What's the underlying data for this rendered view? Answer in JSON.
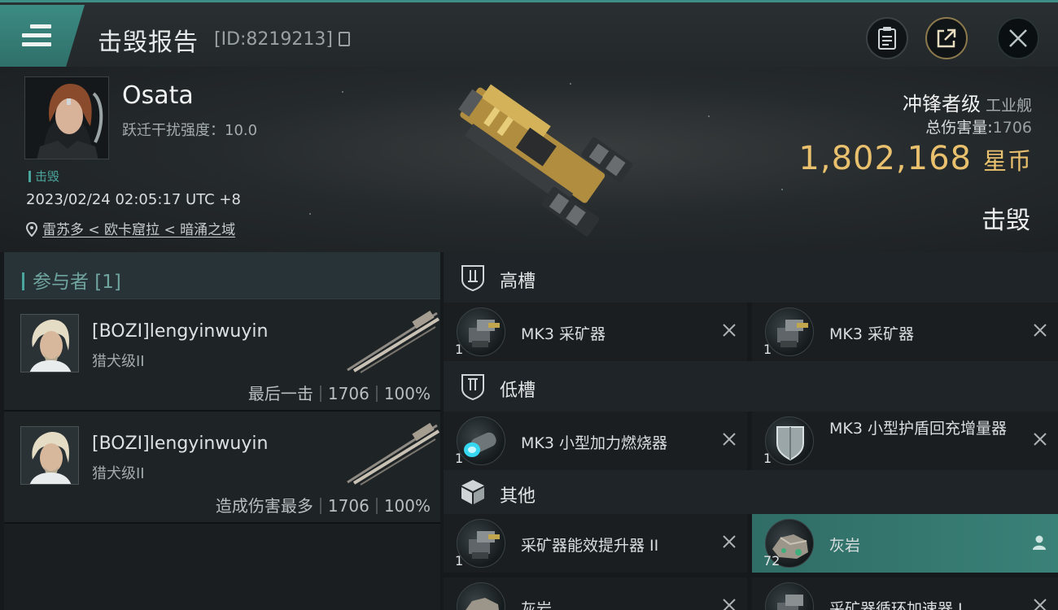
{
  "header": {
    "title": "击毁报告",
    "id_text": "[ID:8219213]"
  },
  "victim": {
    "name": "Osata",
    "warp_scramble": "跃迁干扰强度：10.0",
    "tag": "击毁",
    "datetime": "2023/02/24 02:05:17 UTC +8",
    "location": "雷苏多 < 欧卡窟拉 < 暗涌之域",
    "ship_class": "冲锋者级",
    "ship_type": "工业舰",
    "total_damage_label": "总伤害量:",
    "total_damage": "1706",
    "isk_value": "1,802,168",
    "isk_unit": "星币",
    "status": "击毁"
  },
  "participants": {
    "header": "参与者 [1]",
    "rows": [
      {
        "name": "[BOZI]lengyinwuyin",
        "ship": "猎犬级II",
        "note": "最后一击",
        "damage": "1706",
        "percent": "100%"
      },
      {
        "name": "[BOZI]lengyinwuyin",
        "ship": "猎犬级II",
        "note": "造成伤害最多",
        "damage": "1706",
        "percent": "100%"
      }
    ]
  },
  "fitting": {
    "high": {
      "label": "高槽",
      "items": [
        {
          "name": "MK3 采矿器",
          "qty": "1"
        },
        {
          "name": "MK3 采矿器",
          "qty": "1"
        }
      ]
    },
    "low": {
      "label": "低槽",
      "items": [
        {
          "name": "MK3 小型加力燃烧器",
          "qty": "1"
        },
        {
          "name": "MK3 小型护盾回充增量器",
          "qty": "1"
        }
      ]
    },
    "other": {
      "label": "其他",
      "items": [
        {
          "name": "采矿器能效提升器 II",
          "qty": "1"
        },
        {
          "name": "灰岩",
          "qty": "72"
        },
        {
          "name": "灰岩",
          "qty": ""
        },
        {
          "name": "采矿器循环加速器 I",
          "qty": ""
        }
      ]
    }
  },
  "colors": {
    "accent": "#3d8e86",
    "isk": "#e9c06d",
    "highlight": "#3a8178"
  },
  "icons": [
    "menu-icon",
    "copy-icon",
    "clipboard-icon",
    "share-icon",
    "close-icon",
    "location-pin-icon",
    "high-slot-icon",
    "low-slot-icon",
    "cargo-icon",
    "remove-icon",
    "user-icon"
  ]
}
